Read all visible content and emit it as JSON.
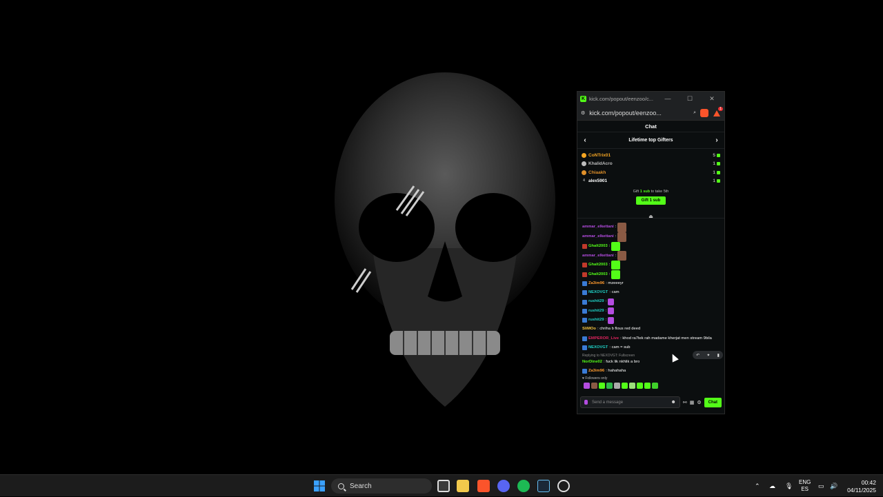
{
  "window": {
    "title": "kick.com/popout/eenzoo/c...",
    "url": "kick.com/popout/eenzoo...",
    "extension_badge": "1"
  },
  "chat": {
    "header": "Chat",
    "gifters_title": "Lifetime top Gifters",
    "gifters": [
      {
        "name": "CoNTrix01",
        "count": "5",
        "color": "#f5a623",
        "rank": ""
      },
      {
        "name": "KhalidAcro",
        "count": "1",
        "color": "#bdbdbd",
        "rank": ""
      },
      {
        "name": "Chiaakh",
        "count": "1",
        "color": "#e0902a",
        "rank": ""
      },
      {
        "name": "alex5901",
        "count": "1",
        "color": "#ffffff",
        "rank": "4"
      }
    ],
    "gift_info_prefix": "Gift",
    "gift_info_bold": "1 sub",
    "gift_info_suffix": "to take 5th",
    "gift_button": "Gift 1 sub",
    "messages": [
      {
        "user": "ammar_elkettani",
        "color": "#b44ce0",
        "text": ":",
        "emote": "face"
      },
      {
        "user": "ammar_elkettani",
        "color": "#b44ce0",
        "text": ":",
        "emote": "face"
      },
      {
        "user": "Ghalt2003",
        "color": "#53fc18",
        "text": ":",
        "emote": "green"
      },
      {
        "user": "ammar_elkettani",
        "color": "#b44ce0",
        "text": ":",
        "emote": "face"
      },
      {
        "user": "Ghalt2003",
        "color": "#53fc18",
        "text": ":",
        "emote": "green"
      },
      {
        "user": "Ghalt2003",
        "color": "#53fc18",
        "text": ":",
        "emote": "green"
      },
      {
        "user": "Za3im96",
        "color": "#ff9a2e",
        "text": ": mzeeeyr",
        "emote": ""
      },
      {
        "user": "NEXOVGT",
        "color": "#1fd1c6",
        "text": ": cam",
        "emote": ""
      },
      {
        "user": "rushit29",
        "color": "#1fd1c6",
        "text": ":",
        "emote": "purple"
      },
      {
        "user": "rushit29",
        "color": "#1fd1c6",
        "text": ":",
        "emote": "purple"
      },
      {
        "user": "rushit29",
        "color": "#1fd1c6",
        "text": ":",
        "emote": "purple"
      },
      {
        "user": "SliMOo",
        "color": "#f5c542",
        "text": ": chriha b flous red deed",
        "emote": ""
      },
      {
        "user": "EMPEROR_Live",
        "color": "#e0245e",
        "text": ": khod ra7tek rah madame kherjat men stream 9bila",
        "emote": ""
      },
      {
        "user": "NEXOVGT",
        "color": "#1fd1c6",
        "text": ": cam = sub",
        "emote": ""
      }
    ],
    "reply_context": "Replying to NEXOVGT: Fullscreen",
    "reply_message": {
      "user": "NorDine02",
      "color": "#53fc18",
      "text": ": fuck lik nkhlik a bro"
    },
    "last_message": {
      "user": "Za3im96",
      "color": "#ff9a2e",
      "text": ": hahahaha"
    },
    "followers_only": "Followers only",
    "input_placeholder": "Send a message",
    "send_button": "Chat"
  },
  "taskbar": {
    "search_label": "Search",
    "lang_top": "ENG",
    "lang_bottom": "ES",
    "time": "00:42",
    "date": "04/11/2025"
  }
}
